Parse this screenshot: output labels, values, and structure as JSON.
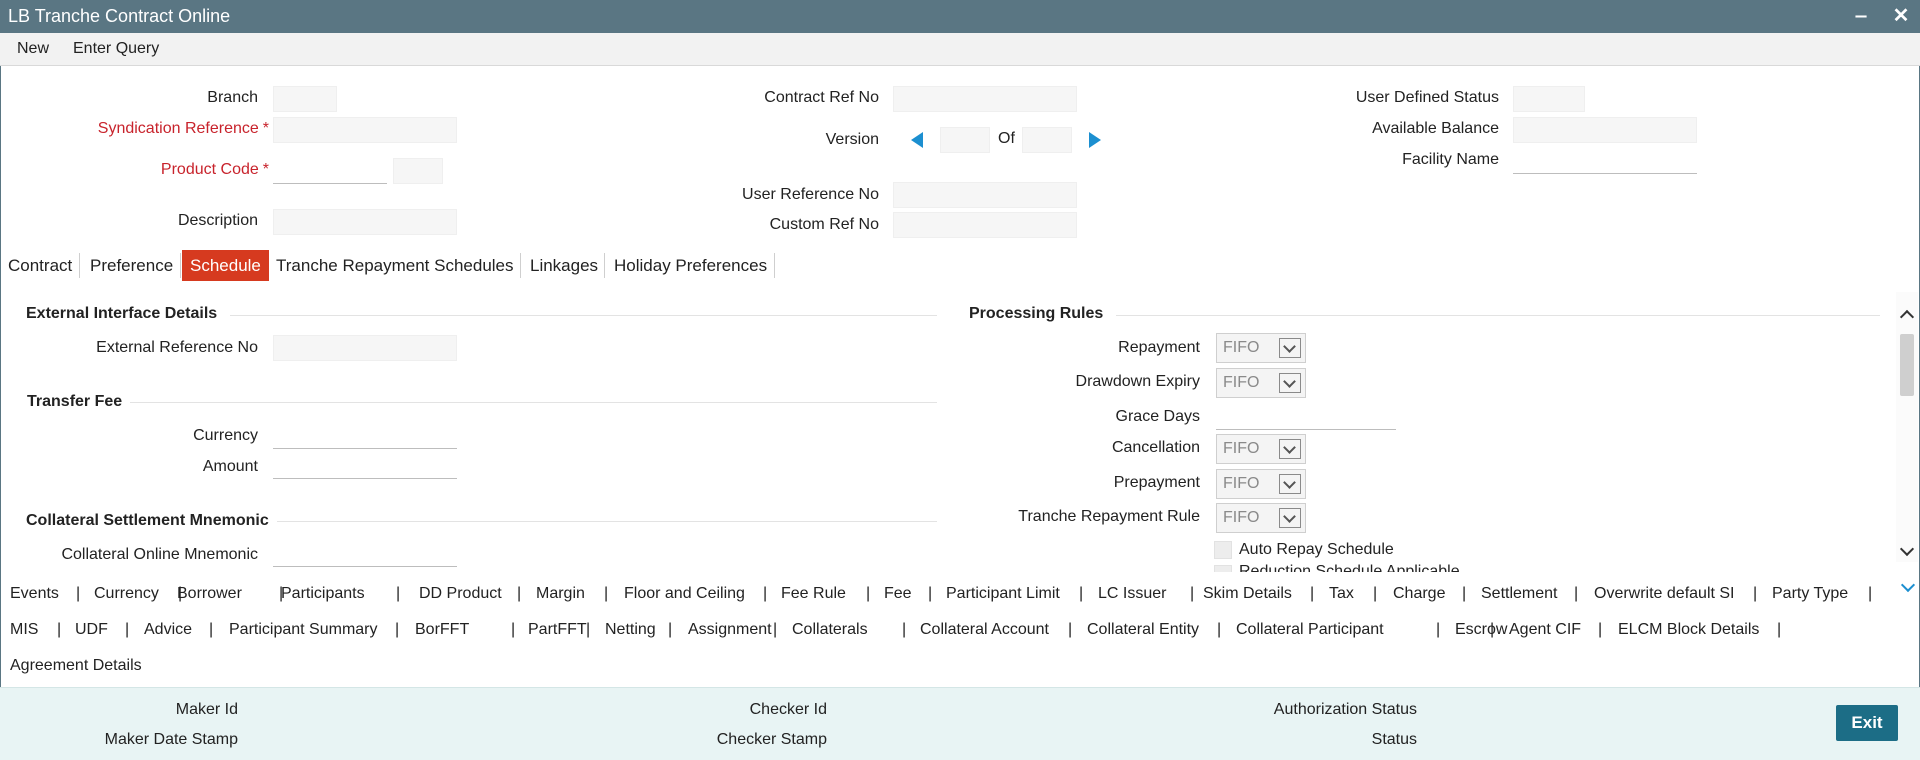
{
  "window": {
    "title": "LB Tranche Contract Online",
    "minimize_glyph": "‒",
    "close_glyph": "✕"
  },
  "toolbar": {
    "new_label": "New",
    "enter_query_label": "Enter Query"
  },
  "header": {
    "branch_label": "Branch",
    "syndication_reference_label": "Syndication Reference",
    "product_code_label": "Product Code",
    "description_label": "Description",
    "contract_ref_no_label": "Contract Ref No",
    "version_label": "Version",
    "of_label": "Of",
    "user_reference_no_label": "User Reference No",
    "custom_ref_no_label": "Custom Ref No",
    "user_defined_status_label": "User Defined Status",
    "available_balance_label": "Available Balance",
    "facility_name_label": "Facility Name",
    "required_marker": "*"
  },
  "tabs": [
    {
      "label": "Contract"
    },
    {
      "label": "Preference"
    },
    {
      "label": "Schedule",
      "active": true
    },
    {
      "label": "Tranche Repayment Schedules"
    },
    {
      "label": "Linkages"
    },
    {
      "label": "Holiday Preferences"
    }
  ],
  "schedule": {
    "external_interface_title": "External Interface Details",
    "external_reference_no_label": "External Reference No",
    "transfer_fee_title": "Transfer Fee",
    "currency_label": "Currency",
    "amount_label": "Amount",
    "collateral_settlement_title": "Collateral Settlement Mnemonic",
    "collateral_online_mnemonic_label": "Collateral Online Mnemonic",
    "processing_rules_title": "Processing Rules",
    "repayment_label": "Repayment",
    "repayment_value": "FIFO",
    "drawdown_expiry_label": "Drawdown Expiry",
    "drawdown_expiry_value": "FIFO",
    "grace_days_label": "Grace Days",
    "cancellation_label": "Cancellation",
    "cancellation_value": "FIFO",
    "prepayment_label": "Prepayment",
    "prepayment_value": "FIFO",
    "tranche_repayment_rule_label": "Tranche Repayment Rule",
    "tranche_repayment_rule_value": "FIFO",
    "auto_repay_schedule_label": "Auto Repay Schedule",
    "reduction_schedule_label": "Reduction Schedule Applicable"
  },
  "subsystems": {
    "separator": "|",
    "row1": [
      "Events",
      "Currency",
      "Borrower",
      "Participants",
      "DD Product",
      "Margin",
      "Floor and Ceiling",
      "Fee Rule",
      "Fee",
      "Participant Limit",
      "LC Issuer",
      "Skim Details",
      "Tax",
      "Charge",
      "Settlement",
      "Overwrite default SI",
      "Party Type"
    ],
    "row2": [
      "MIS",
      "UDF",
      "Advice",
      "Participant Summary",
      "BorFFT",
      "PartFFT",
      "Netting",
      "Assignment",
      "Collaterals",
      "Collateral Account",
      "Collateral Entity",
      "Collateral Participant",
      "Escrow",
      "Agent CIF",
      "ELCM Block Details"
    ],
    "row3": [
      "Agreement Details"
    ]
  },
  "footer": {
    "maker_id_label": "Maker Id",
    "maker_date_stamp_label": "Maker Date Stamp",
    "checker_id_label": "Checker Id",
    "checker_stamp_label": "Checker Stamp",
    "authorization_status_label": "Authorization Status",
    "status_label": "Status",
    "exit_label": "Exit"
  }
}
